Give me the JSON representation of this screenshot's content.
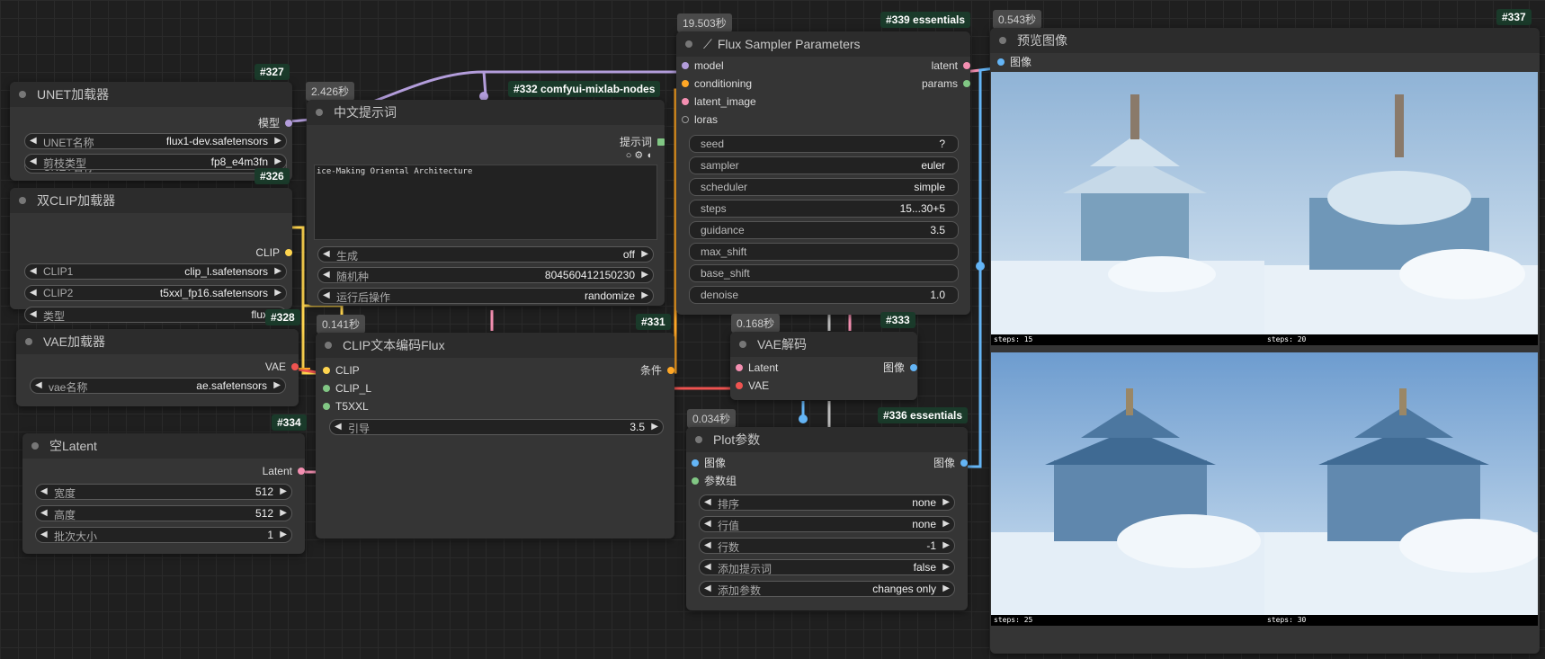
{
  "nodes": {
    "unet": {
      "title": "UNET加载器",
      "badge": "#327",
      "out_label": "模型",
      "widgets": [
        {
          "label": "UNET名称",
          "value": "flux1-dev.safetensors"
        },
        {
          "label": "剪枝类型",
          "value": "fp8_e4m3fn"
        }
      ]
    },
    "dualclip": {
      "title": "双CLIP加载器",
      "badge": "#326",
      "out_label": "CLIP",
      "widgets": [
        {
          "label": "CLIP1",
          "value": "clip_l.safetensors"
        },
        {
          "label": "CLIP2",
          "value": "t5xxl_fp16.safetensors"
        },
        {
          "label": "类型",
          "value": "flux"
        }
      ]
    },
    "vae_loader": {
      "title": "VAE加载器",
      "badge": "#328",
      "out_label": "VAE",
      "widgets": [
        {
          "label": "vae名称",
          "value": "ae.safetensors"
        }
      ]
    },
    "empty_latent": {
      "title": "空Latent",
      "badge": "#334",
      "out_label": "Latent",
      "widgets": [
        {
          "label": "宽度",
          "value": "512"
        },
        {
          "label": "高度",
          "value": "512"
        },
        {
          "label": "批次大小",
          "value": "1"
        }
      ]
    },
    "cn_prompt": {
      "title": "中文提示词",
      "badge": "#332 comfyui-mixlab-nodes",
      "timing": "2.426秒",
      "out_label": "提示词",
      "text": "ice-Making Oriental Architecture",
      "widgets": [
        {
          "label": "生成",
          "value": "off"
        },
        {
          "label": "随机种",
          "value": "804560412150230"
        },
        {
          "label": "运行后操作",
          "value": "randomize"
        }
      ]
    },
    "clip_encode": {
      "title": "CLIP文本编码Flux",
      "badge": "#331",
      "timing": "0.141秒",
      "inputs": [
        "CLIP",
        "CLIP_L",
        "T5XXL"
      ],
      "out_label": "条件",
      "widgets": [
        {
          "label": "引导",
          "value": "3.5"
        }
      ]
    },
    "flux_sampler": {
      "title": "Flux Sampler Parameters",
      "badge": "#339 essentials",
      "timing": "19.503秒",
      "inputs": [
        "model",
        "conditioning",
        "latent_image",
        "loras"
      ],
      "outputs": [
        "latent",
        "params"
      ],
      "widgets": [
        {
          "label": "seed",
          "value": "?"
        },
        {
          "label": "sampler",
          "value": "euler"
        },
        {
          "label": "scheduler",
          "value": "simple"
        },
        {
          "label": "steps",
          "value": "15...30+5"
        },
        {
          "label": "guidance",
          "value": "3.5"
        },
        {
          "label": "max_shift",
          "value": ""
        },
        {
          "label": "base_shift",
          "value": ""
        },
        {
          "label": "denoise",
          "value": "1.0"
        }
      ]
    },
    "vae_decode": {
      "title": "VAE解码",
      "badge": "#333",
      "timing": "0.168秒",
      "inputs": [
        "Latent",
        "VAE"
      ],
      "out_label": "图像"
    },
    "plot": {
      "title": "Plot参数",
      "badge": "#336 essentials",
      "timing": "0.034秒",
      "inputs": [
        "图像",
        "参数组"
      ],
      "out_label": "图像",
      "widgets": [
        {
          "label": "排序",
          "value": "none"
        },
        {
          "label": "行值",
          "value": "none"
        },
        {
          "label": "行数",
          "value": "-1"
        },
        {
          "label": "添加提示词",
          "value": "false"
        },
        {
          "label": "添加参数",
          "value": "changes only"
        }
      ]
    },
    "preview": {
      "title": "预览图像",
      "badge": "#337",
      "timing": "0.543秒",
      "in_label": "图像",
      "captions": [
        "steps: 15",
        "steps: 20",
        "steps: 25",
        "steps: 30"
      ]
    }
  },
  "colors": {
    "model": "#b39ddb",
    "clip": "#ffd54f",
    "vae": "#ef5350",
    "latent": "#f48fb1",
    "image": "#64b5f6",
    "conditioning": "#ffa726",
    "green": "#81c784",
    "badge_bg": "#1a3a2a"
  },
  "icons": {
    "arrow_left": "◀",
    "arrow_right": "▶"
  }
}
